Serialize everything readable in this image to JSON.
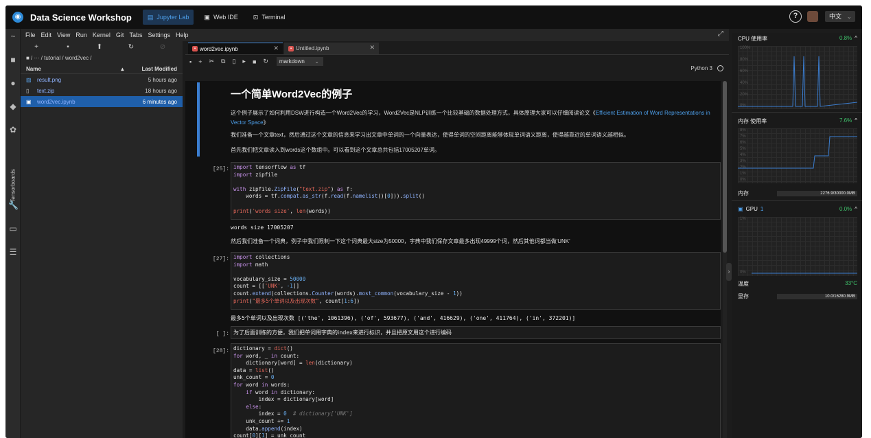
{
  "app": {
    "title": "Data Science Workshop"
  },
  "topnav": {
    "tabs": [
      {
        "label": "Jupyter Lab"
      },
      {
        "label": "Web IDE"
      },
      {
        "label": "Terminal"
      }
    ],
    "language": "中文"
  },
  "menu": {
    "items": [
      "File",
      "Edit",
      "View",
      "Run",
      "Kernel",
      "Git",
      "Tabs",
      "Settings",
      "Help"
    ]
  },
  "leftbar": {
    "tensorboards_label": "Tensorboards"
  },
  "filebrowser": {
    "breadcrumb": "■ / ··· / tutorial / word2vec /",
    "col_name": "Name",
    "col_modified": "Last Modified",
    "files": [
      {
        "name": "result.png",
        "modified": "5 hours ago"
      },
      {
        "name": "text.zip",
        "modified": "18 hours ago"
      },
      {
        "name": "word2vec.ipynb",
        "modified": "6 minutes ago"
      }
    ]
  },
  "notebook": {
    "tabs": [
      {
        "label": "word2vec.ipynb"
      },
      {
        "label": "Untitled.ipynb"
      }
    ],
    "cell_type": "markdown",
    "kernel": "Python 3",
    "heading": "一个简单Word2Vec的例子",
    "md1a": "这个例子展示了如何利用DSW进行构造一个Word2Vec的学习，Word2Vec是NLP训练一个比较基础的数据处理方式，具体原理大家可以仔细阅读论文《",
    "md1_link": "Efficient Estimation of Word Representations in Vector Space",
    "md1b": "》",
    "md2": "我们准备一个文章text，然后通过这个文章的信息来学习出文章中单词的一个向量表达，使得单词的空间距离能够体现单词语义距离，使得越靠近的单词语义越相似。",
    "md3": "首先我们把文章读入到words这个数组中。可以看到这个文章总共包括17005207单词。",
    "p1": "[25]:",
    "p2": "[27]:",
    "p3": "[ ]:",
    "p4": "[28]:",
    "out1": "words size 17005207",
    "md4": "然后我们准备一个词典，例子中我们限制一下这个词典最大size为50000，字典中我们保存文章最多出现49999个词，然后其他词都当做'UNK'",
    "out2": "最多5个单词以及出现次数 [('the', 1061396), ('of', 593677), ('and', 416629), ('one', 411764), ('in', 372201)]",
    "raw1": "为了后面训练的方便，我们把单词用字典的index来进行标识，并且把原文用这个进行编码"
  },
  "monitor": {
    "cpu_label": "CPU 使用率",
    "cpu_value": "0.8%",
    "mem_label": "内存 使用率",
    "mem_value": "7.6%",
    "mem_bar_label": "内存",
    "mem_bar_value": "2276.9/30000.0MB",
    "gpu_label": "GPU",
    "gpu_index": "1",
    "gpu_value": "0.0%",
    "temp_label": "温度",
    "temp_value": "33°C",
    "vram_label": "显存",
    "vram_value": "10.0/16280.9MB",
    "cpu_ticks": [
      "100%",
      "80%",
      "60%",
      "40%",
      "20%",
      "0%"
    ],
    "mem_ticks": [
      "8%",
      "7%",
      "6%",
      "5%",
      "4%",
      "3%",
      "2%",
      "1%",
      "0%"
    ],
    "gpu_ticks": [
      "1%",
      "0%"
    ],
    "accent": "#3fbf6a"
  }
}
